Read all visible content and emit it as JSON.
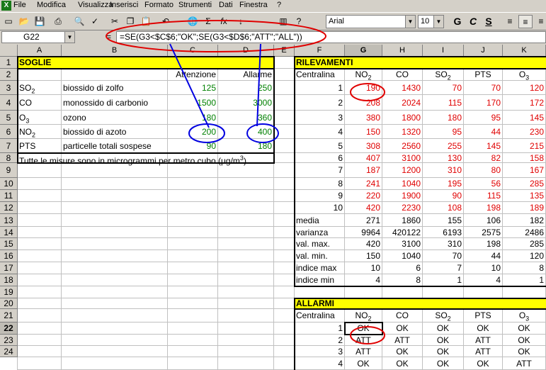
{
  "menu": [
    "File",
    "Modifica",
    "Visualizza",
    "Inserisci",
    "Formato",
    "Strumenti",
    "Dati",
    "Finestra",
    "?"
  ],
  "toolbar": {
    "font": "Arial",
    "size": "10",
    "bold": "G",
    "italic": "C",
    "underline": "S"
  },
  "namebox": "G22",
  "formula": "=SE(G3<$C$6;\"OK\";SE(G3<$D$6;\"ATT\";\"ALL\"))",
  "columns": [
    "A",
    "B",
    "C",
    "D",
    "E",
    "F",
    "G",
    "H",
    "I",
    "J",
    "K"
  ],
  "rows": [
    "1",
    "2",
    "3",
    "4",
    "5",
    "6",
    "7",
    "8",
    "9",
    "10",
    "11",
    "12",
    "13",
    "14",
    "15",
    "16",
    "17",
    "18",
    "19",
    "20",
    "21",
    "22",
    "23",
    "24"
  ],
  "soglie": {
    "title": "SOGLIE",
    "h_att": "Attenzione",
    "h_all": "Allarme",
    "items": [
      {
        "code": "SO",
        "sub": "2",
        "name": "biossido di zolfo",
        "att": "125",
        "all": "250"
      },
      {
        "code": "CO",
        "sub": "",
        "name": "monossido di carbonio",
        "att": "1500",
        "all": "3000"
      },
      {
        "code": "O",
        "sub": "3",
        "name": "ozono",
        "att": "180",
        "all": "360"
      },
      {
        "code": "NO",
        "sub": "2",
        "name": "biossido di azoto",
        "att": "200",
        "all": "400"
      },
      {
        "code": "PTS",
        "sub": "",
        "name": "particelle totali sospese",
        "att": "90",
        "all": "180"
      }
    ],
    "note_a": "Tutte le misure sono in microgrammi per metro cubo (",
    "note_mu": "μ",
    "note_b": "g/m",
    "note_sup": "3",
    "note_c": ")"
  },
  "ril": {
    "title": "RILEVAMENTI",
    "label": "Centralina",
    "heads": [
      {
        "t": "NO",
        "s": "2"
      },
      {
        "t": "CO",
        "s": ""
      },
      {
        "t": "SO",
        "s": "2"
      },
      {
        "t": "PTS",
        "s": ""
      },
      {
        "t": "O",
        "s": "3"
      }
    ],
    "data": [
      [
        "1",
        "190",
        "1430",
        "70",
        "70",
        "120"
      ],
      [
        "2",
        "208",
        "2024",
        "115",
        "170",
        "172"
      ],
      [
        "3",
        "380",
        "1800",
        "180",
        "95",
        "145"
      ],
      [
        "4",
        "150",
        "1320",
        "95",
        "44",
        "230"
      ],
      [
        "5",
        "308",
        "2560",
        "255",
        "145",
        "215"
      ],
      [
        "6",
        "407",
        "3100",
        "130",
        "82",
        "158"
      ],
      [
        "7",
        "187",
        "1200",
        "310",
        "80",
        "167"
      ],
      [
        "8",
        "241",
        "1040",
        "195",
        "56",
        "285"
      ],
      [
        "9",
        "220",
        "1900",
        "90",
        "115",
        "135"
      ],
      [
        "10",
        "420",
        "2230",
        "108",
        "198",
        "189"
      ]
    ],
    "stats": [
      [
        "media",
        "271",
        "1860",
        "155",
        "106",
        "182"
      ],
      [
        "varianza",
        "9964",
        "420122",
        "6193",
        "2575",
        "2486"
      ],
      [
        "val. max.",
        "420",
        "3100",
        "310",
        "198",
        "285"
      ],
      [
        "val. min.",
        "150",
        "1040",
        "70",
        "44",
        "120"
      ],
      [
        "indice max",
        "10",
        "6",
        "7",
        "10",
        "8"
      ],
      [
        "indice min",
        "4",
        "8",
        "1",
        "4",
        "1"
      ]
    ]
  },
  "allarmi": {
    "title": "ALLARMI",
    "label": "Centralina",
    "rows": [
      [
        "1",
        "OK",
        "OK",
        "OK",
        "OK",
        "OK"
      ],
      [
        "2",
        "ATT",
        "ATT",
        "OK",
        "ATT",
        "OK"
      ],
      [
        "3",
        "ATT",
        "OK",
        "OK",
        "ATT",
        "OK"
      ],
      [
        "4",
        "OK",
        "OK",
        "OK",
        "OK",
        "ATT"
      ]
    ]
  },
  "colors": {
    "header_yellow": "#ffff00",
    "data_red": "#e00000",
    "threshold_green": "#008000",
    "annot_red": "#e00000",
    "annot_blue": "#0000e0"
  }
}
